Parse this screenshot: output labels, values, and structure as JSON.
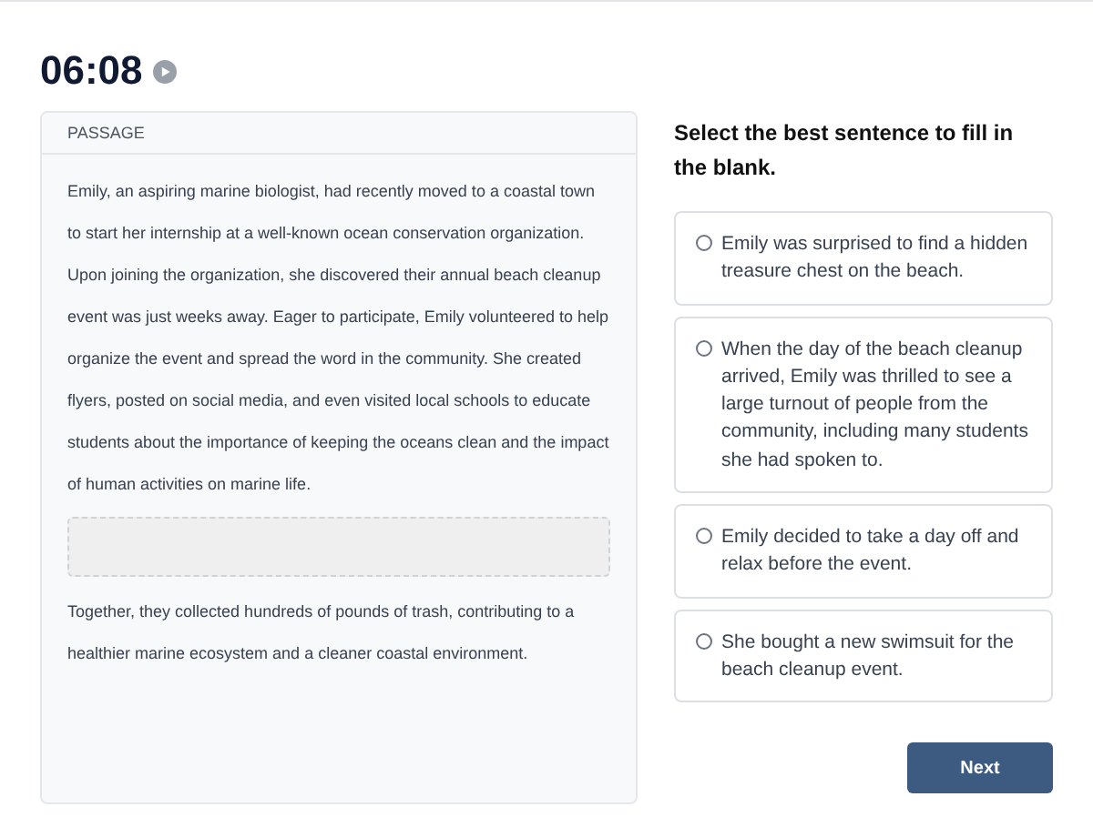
{
  "timer": {
    "time": "06:08"
  },
  "passage": {
    "header": "PASSAGE",
    "before": "Emily, an aspiring marine biologist, had recently moved to a coastal town to start her internship at a well-known ocean conservation organization. Upon joining the organization, she discovered their annual beach cleanup event was just weeks away. Eager to participate, Emily volunteered to help organize the event and spread the word in the community. She created flyers, posted on social media, and even visited local schools to educate students about the importance of keeping the oceans clean and the impact of human activities on marine life.",
    "after": "Together, they collected hundreds of pounds of trash, contributing to a healthier marine ecosystem and a cleaner coastal environment."
  },
  "question": "Select the best sentence to fill in the blank.",
  "options": [
    {
      "text": "Emily was surprised to find a hidden treasure chest on the beach.",
      "selected": false
    },
    {
      "text": "When the day of the beach cleanup arrived, Emily was thrilled to see a large turnout of people from the community, including many students she had spoken to.",
      "selected": false
    },
    {
      "text": "Emily decided to take a day off and relax before the event.",
      "selected": false
    },
    {
      "text": "She bought a new swimsuit for the beach cleanup event.",
      "selected": false
    }
  ],
  "next_button": "Next"
}
